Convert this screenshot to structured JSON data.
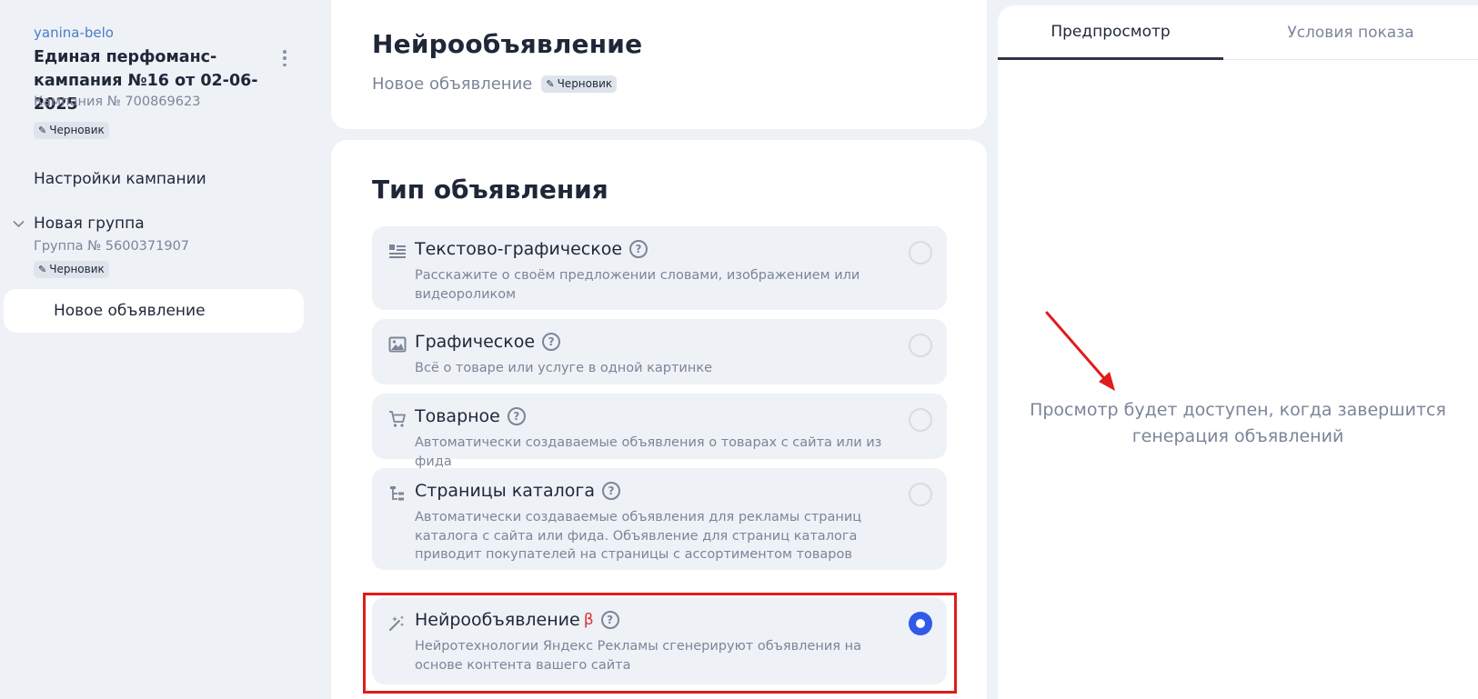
{
  "sidebar": {
    "account": "yanina-belo",
    "campaign_title": "Единая перфоманс-кампания №16 от 02-06-2025",
    "campaign_number": "Кампания № 700869623",
    "campaign_badge": "Черновик",
    "settings_label": "Настройки кампании",
    "group_title": "Новая группа",
    "group_number": "Группа № 5600371907",
    "group_badge": "Черновик",
    "ad_item_label": "Новое объявление"
  },
  "header": {
    "title": "Нейрообъявление",
    "subtitle": "Новое объявление",
    "badge": "Черновик"
  },
  "ad_type": {
    "section_title": "Тип объявления",
    "options": [
      {
        "icon": "text-graphic-icon",
        "title": "Текстово-графическое",
        "description": "Расскажите о своём предложении словами, изображением или видеороликом",
        "selected": false
      },
      {
        "icon": "image-icon",
        "title": "Графическое",
        "description": "Всё о товаре или услуге в одной картинке",
        "selected": false
      },
      {
        "icon": "cart-icon",
        "title": "Товарное",
        "description": "Автоматически создаваемые объявления о товарах с сайта или из фида",
        "selected": false
      },
      {
        "icon": "catalog-tree-icon",
        "title": "Страницы каталога",
        "description": "Автоматически создаваемые объявления для рекламы страниц каталога с сайта или фида. Объявление для страниц каталога приводит покупателей на страницы с ассортиментом товаров",
        "selected": false
      },
      {
        "icon": "magic-wand-icon",
        "title": "Нейрообъявление",
        "beta": "β",
        "description": "Нейротехнологии Яндекс Рекламы сгенерируют объявления на основе контента вашего сайта",
        "selected": true
      }
    ]
  },
  "right_panel": {
    "tabs": [
      "Предпросмотр",
      "Условия показа"
    ],
    "active_tab": "Предпросмотр",
    "preview_message": "Просмотр будет доступен, когда завершится генерация объявлений"
  },
  "colors": {
    "accent": "#2f5be7",
    "highlight": "#e01c1c",
    "link": "#4a7cc7",
    "background": "#eef1f6"
  }
}
